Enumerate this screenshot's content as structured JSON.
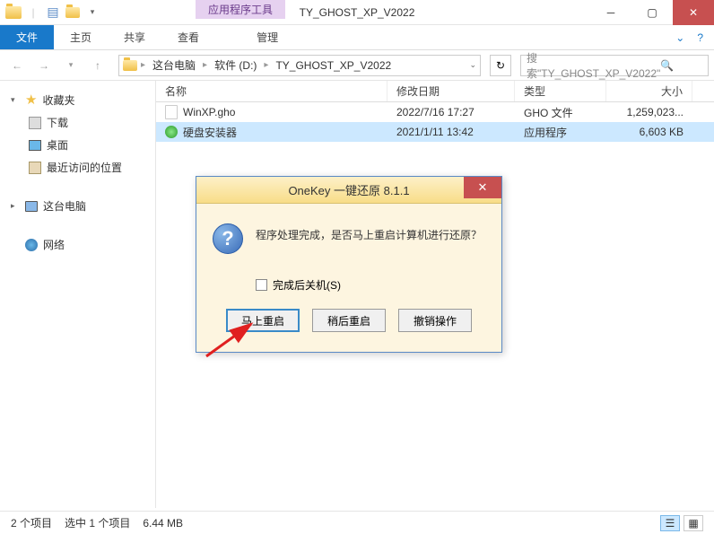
{
  "window": {
    "tool_tab": "应用程序工具",
    "title": "TY_GHOST_XP_V2022"
  },
  "ribbon": {
    "tabs": [
      "文件",
      "主页",
      "共享",
      "查看"
    ],
    "manage": "管理"
  },
  "breadcrumb": {
    "items": [
      "这台电脑",
      "软件 (D:)",
      "TY_GHOST_XP_V2022"
    ]
  },
  "search": {
    "placeholder": "搜索\"TY_GHOST_XP_V2022\""
  },
  "sidebar": {
    "favorites": "收藏夹",
    "fav_items": [
      {
        "label": "下载",
        "icon": "dl"
      },
      {
        "label": "桌面",
        "icon": "desktop"
      },
      {
        "label": "最近访问的位置",
        "icon": "recent"
      }
    ],
    "computer": "这台电脑",
    "network": "网络"
  },
  "columns": {
    "name": "名称",
    "date": "修改日期",
    "type": "类型",
    "size": "大小"
  },
  "files": [
    {
      "name": "WinXP.gho",
      "date": "2022/7/16 17:27",
      "type": "GHO 文件",
      "size": "1,259,023...",
      "icon": "file",
      "selected": false
    },
    {
      "name": "硬盘安装器",
      "date": "2021/1/11 13:42",
      "type": "应用程序",
      "size": "6,603 KB",
      "icon": "app",
      "selected": true
    }
  ],
  "status": {
    "count": "2 个项目",
    "selection": "选中 1 个项目",
    "size": "6.44 MB"
  },
  "dialog": {
    "title": "OneKey 一键还原 8.1.1",
    "message": "程序处理完成，是否马上重启计算机进行还原？",
    "checkbox": "完成后关机(S)",
    "buttons": {
      "restart": "马上重启",
      "later": "稍后重启",
      "cancel": "撤销操作"
    }
  }
}
